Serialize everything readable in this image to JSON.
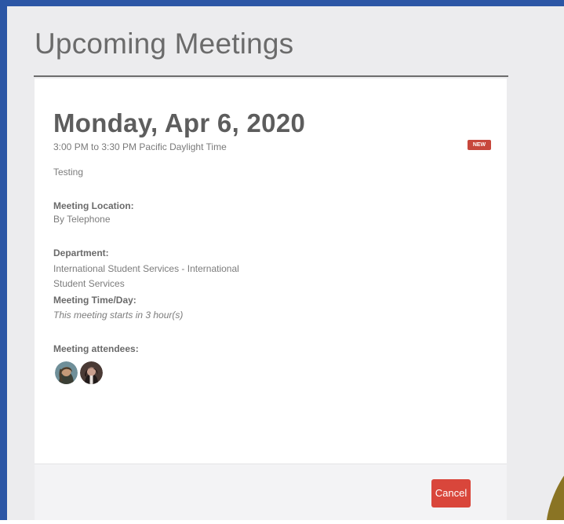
{
  "page": {
    "title": "Upcoming Meetings"
  },
  "meeting": {
    "date": "Monday, Apr 6, 2020",
    "time_range": "3:00 PM to 3:30 PM Pacific Daylight Time",
    "badge": "NEW",
    "description": "Testing",
    "location_label": "Meeting Location:",
    "location_value": "By Telephone",
    "department_label": "Department:",
    "department_line1": "International Student Services - International",
    "department_line2": "Student Services",
    "time_label": "Meeting Time/Day:",
    "time_value": "This meeting starts in 3 hour(s)",
    "attendees_label": "Meeting attendees:",
    "attendees": [
      {
        "icon": "attendee-avatar-1"
      },
      {
        "icon": "attendee-avatar-2"
      }
    ]
  },
  "actions": {
    "cancel_label": "Cancel"
  },
  "colors": {
    "frame": "#2c56a5",
    "background": "#ececee",
    "badge": "#c7473c",
    "cancel": "#d9463b",
    "pointer_arrow": "#8a7424"
  }
}
